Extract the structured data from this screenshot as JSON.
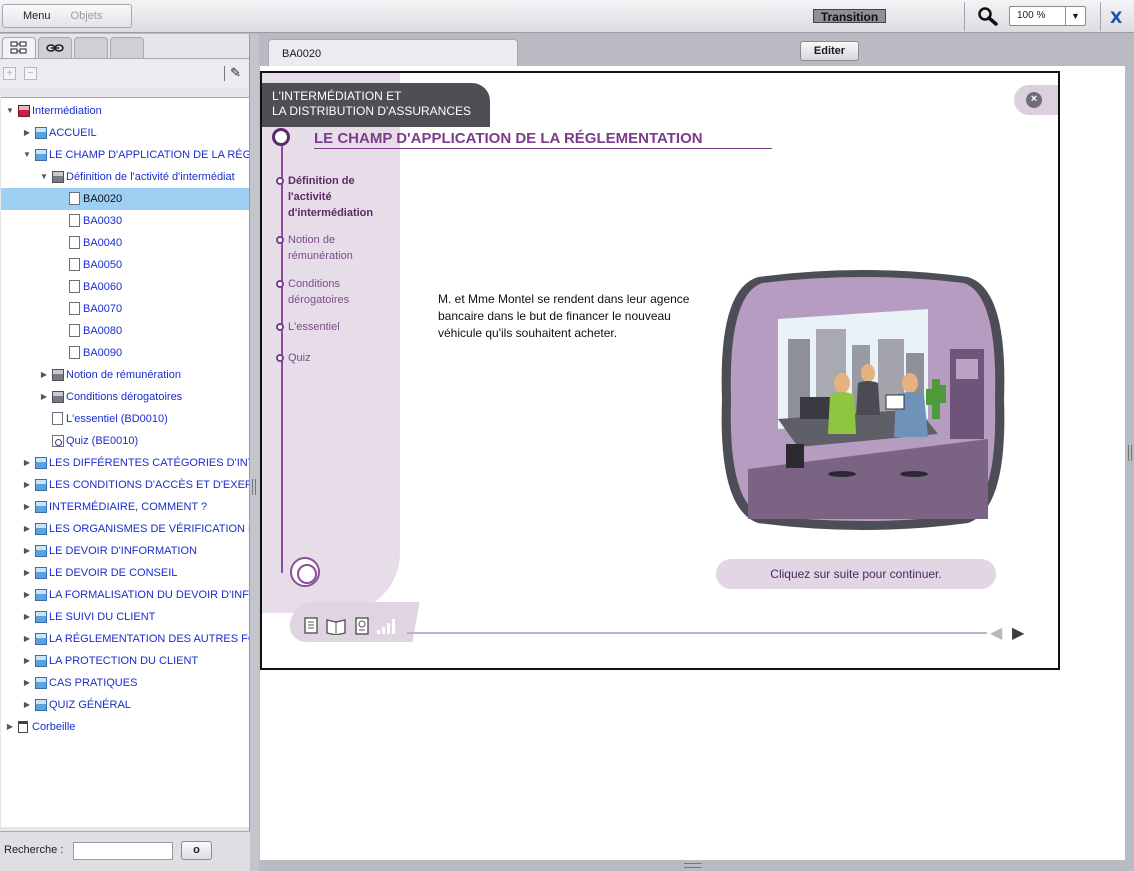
{
  "toolbar": {
    "menu_label": "Menu",
    "objects_label": "Objets",
    "transition_label": "Transition",
    "zoom_value": "100 %",
    "close_label": "X"
  },
  "tree": {
    "items": [
      {
        "label": "Intermédiation",
        "level": 0,
        "icon": "root",
        "toggle": "open"
      },
      {
        "label": "ACCUEIL",
        "level": 1,
        "icon": "sec",
        "toggle": "closed"
      },
      {
        "label": "LE CHAMP D'APPLICATION DE LA RÉGL",
        "level": 1,
        "icon": "sec",
        "toggle": "open"
      },
      {
        "label": "Définition de l'activité d'intermédiat",
        "level": 2,
        "icon": "sub",
        "toggle": "open"
      },
      {
        "label": "BA0020",
        "level": 3,
        "icon": "page",
        "toggle": "",
        "selected": true
      },
      {
        "label": "BA0030",
        "level": 3,
        "icon": "page",
        "toggle": ""
      },
      {
        "label": "BA0040",
        "level": 3,
        "icon": "page",
        "toggle": ""
      },
      {
        "label": "BA0050",
        "level": 3,
        "icon": "page",
        "toggle": ""
      },
      {
        "label": "BA0060",
        "level": 3,
        "icon": "page",
        "toggle": ""
      },
      {
        "label": "BA0070",
        "level": 3,
        "icon": "page",
        "toggle": ""
      },
      {
        "label": "BA0080",
        "level": 3,
        "icon": "page",
        "toggle": ""
      },
      {
        "label": "BA0090",
        "level": 3,
        "icon": "page",
        "toggle": ""
      },
      {
        "label": "Notion de rémunération",
        "level": 2,
        "icon": "sub",
        "toggle": "closed"
      },
      {
        "label": "Conditions dérogatoires",
        "level": 2,
        "icon": "sub",
        "toggle": "closed"
      },
      {
        "label": "L'essentiel (BD0010)",
        "level": 2,
        "icon": "page",
        "toggle": ""
      },
      {
        "label": "Quiz (BE0010)",
        "level": 2,
        "icon": "quiz",
        "toggle": ""
      },
      {
        "label": "LES DIFFÉRENTES CATÉGORIES D'INTI",
        "level": 1,
        "icon": "sec",
        "toggle": "closed"
      },
      {
        "label": "LES CONDITIONS D'ACCÈS ET D'EXERC",
        "level": 1,
        "icon": "sec",
        "toggle": "closed"
      },
      {
        "label": "INTERMÉDIAIRE, COMMENT ?",
        "level": 1,
        "icon": "sec",
        "toggle": "closed"
      },
      {
        "label": "LES ORGANISMES DE VÉRIFICATION E",
        "level": 1,
        "icon": "sec",
        "toggle": "closed"
      },
      {
        "label": "LE DEVOIR D'INFORMATION",
        "level": 1,
        "icon": "sec",
        "toggle": "closed"
      },
      {
        "label": "LE DEVOIR DE CONSEIL",
        "level": 1,
        "icon": "sec",
        "toggle": "closed"
      },
      {
        "label": "LA FORMALISATION DU DEVOIR D'INFO",
        "level": 1,
        "icon": "sec",
        "toggle": "closed"
      },
      {
        "label": "LE SUIVI DU CLIENT",
        "level": 1,
        "icon": "sec",
        "toggle": "closed"
      },
      {
        "label": "LA RÉGLEMENTATION DES AUTRES FO",
        "level": 1,
        "icon": "sec",
        "toggle": "closed"
      },
      {
        "label": "LA PROTECTION DU CLIENT",
        "level": 1,
        "icon": "sec",
        "toggle": "closed"
      },
      {
        "label": "CAS PRATIQUES",
        "level": 1,
        "icon": "sec",
        "toggle": "closed"
      },
      {
        "label": "QUIZ GÉNÉRAL",
        "level": 1,
        "icon": "sec",
        "toggle": "closed"
      },
      {
        "label": "Corbeille",
        "level": 0,
        "icon": "trash",
        "toggle": "closed"
      }
    ]
  },
  "search": {
    "label": "Recherche :",
    "value": "",
    "button_label": "o"
  },
  "document": {
    "tab_label": "BA0020",
    "edit_label": "Editer"
  },
  "slide": {
    "course_title_line1": "L'INTERMÉDIATION ET",
    "course_title_line2": "LA DISTRIBUTION D'ASSURANCES",
    "title": "LE CHAMP D'APPLICATION DE LA RÉGLEMENTATION",
    "steps": [
      {
        "label": "Définition de l'activité d'intermédiation",
        "active": true
      },
      {
        "label": "Notion de rémunération",
        "active": false
      },
      {
        "label": "Conditions dérogatoires",
        "active": false
      },
      {
        "label": "L'essentiel",
        "active": false
      },
      {
        "label": "Quiz",
        "active": false
      }
    ],
    "body_text": "M. et Mme Montel se rendent dans leur agence bancaire dans le but de financer le nouveau véhicule qu'ils souhaitent acheter.",
    "continue_text": "Cliquez sur suite pour continuer.",
    "close_glyph": "×"
  },
  "colors": {
    "accent_purple": "#7a3d8a",
    "selection_blue": "#9dd0f3",
    "tree_link": "#1a2dcf"
  }
}
